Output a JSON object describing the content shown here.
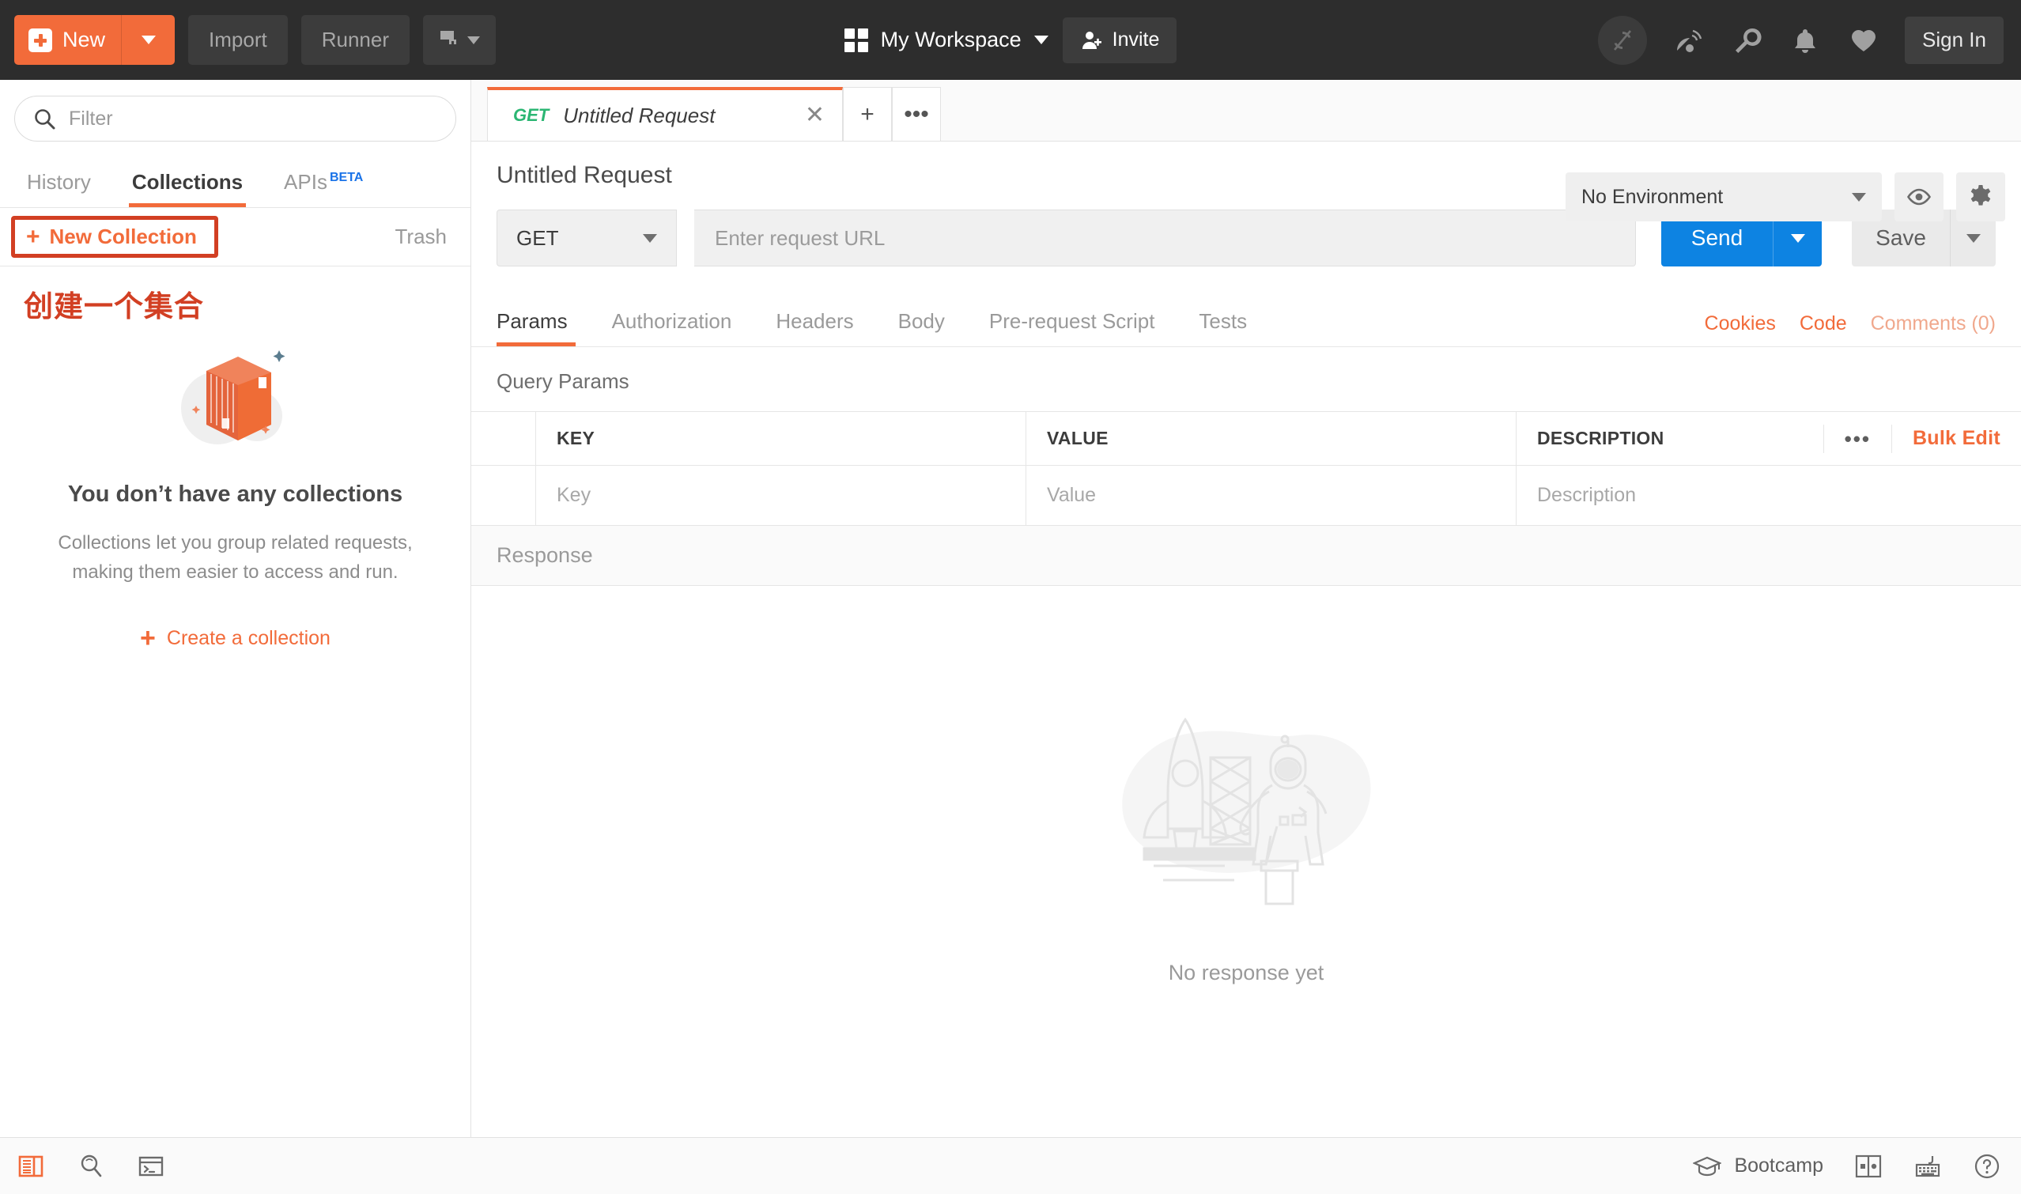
{
  "topbar": {
    "new_button": {
      "label": "New",
      "icon": "plus-square-icon",
      "caret": "chevron-down-icon"
    },
    "import_label": "Import",
    "runner_label": "Runner",
    "new_window_icon": "new-window-icon",
    "workspace": {
      "label": "My Workspace",
      "icon": "grid-icon",
      "caret": "chevron-down-icon"
    },
    "invite_label": "Invite",
    "icons": [
      {
        "name": "sync-disabled-icon"
      },
      {
        "name": "satellite-dish-icon"
      },
      {
        "name": "wrench-icon"
      },
      {
        "name": "bell-icon"
      },
      {
        "name": "heart-icon"
      }
    ],
    "sign_in_label": "Sign In",
    "accent_color": "#f26b3a",
    "background_color": "#2d2d2d"
  },
  "sidebar": {
    "filter": {
      "placeholder": "Filter",
      "value": "",
      "icon": "search-icon"
    },
    "tabs": [
      {
        "label": "History",
        "active": false
      },
      {
        "label": "Collections",
        "active": true
      },
      {
        "label": "APIs",
        "active": false,
        "badge": "BETA"
      }
    ],
    "new_collection_label": "New Collection",
    "trash_label": "Trash",
    "annotation_cn": "创建一个集合",
    "annotation_color": "#d23f23",
    "empty_state": {
      "illustration": "collection-box-illustration",
      "title": "You don’t have any collections",
      "description": "Collections let you group related requests, making them easier to access and run.",
      "cta_label": "Create a collection"
    }
  },
  "request_tabs": {
    "tabs": [
      {
        "method": "GET",
        "name": "Untitled Request",
        "active": true,
        "close_icon": "close-icon"
      }
    ],
    "add_tab_icon": "plus-icon",
    "more_tabs_icon": "ellipsis-icon"
  },
  "environment": {
    "selected": "No Environment",
    "eye_icon": "eye-icon",
    "settings_icon": "gear-icon"
  },
  "request": {
    "title": "Untitled Request",
    "method": "GET",
    "url_placeholder": "Enter request URL",
    "url_value": "",
    "send_label": "Send",
    "save_label": "Save",
    "send_color": "#0d83e2",
    "tabs": [
      {
        "label": "Params",
        "active": true
      },
      {
        "label": "Authorization",
        "active": false
      },
      {
        "label": "Headers",
        "active": false
      },
      {
        "label": "Body",
        "active": false
      },
      {
        "label": "Pre-request Script",
        "active": false
      },
      {
        "label": "Tests",
        "active": false
      }
    ],
    "links": [
      {
        "label": "Cookies",
        "muted": false
      },
      {
        "label": "Code",
        "muted": false
      },
      {
        "label": "Comments (0)",
        "muted": true
      }
    ],
    "query_params": {
      "section_title": "Query Params",
      "columns": [
        "KEY",
        "VALUE",
        "DESCRIPTION"
      ],
      "rows": [
        {
          "key": "Key",
          "value": "Value",
          "description": "Description"
        }
      ],
      "more_icon": "ellipsis-icon",
      "bulk_edit_label": "Bulk Edit"
    }
  },
  "response": {
    "header_label": "Response",
    "empty_text": "No response yet",
    "illustration": "rocket-astronaut-illustration"
  },
  "statusbar": {
    "left_icons": [
      {
        "name": "sidebar-toggle-icon",
        "active": true
      },
      {
        "name": "find-icon",
        "active": false
      },
      {
        "name": "console-icon",
        "active": false
      }
    ],
    "bootcamp_label": "Bootcamp",
    "bootcamp_icon": "graduation-cap-icon",
    "right_icons": [
      {
        "name": "two-pane-layout-icon"
      },
      {
        "name": "keyboard-shortcuts-icon"
      },
      {
        "name": "help-circle-icon"
      }
    ]
  }
}
